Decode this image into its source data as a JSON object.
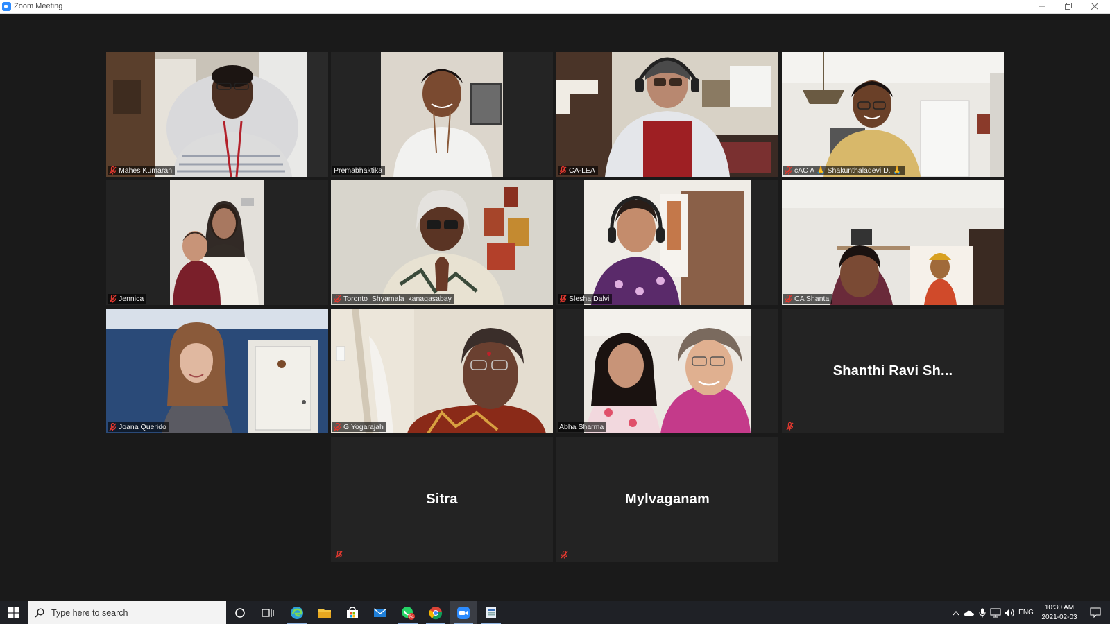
{
  "window": {
    "title": "Zoom Meeting"
  },
  "participants": [
    {
      "name": "Mahes Kumaran",
      "muted": true,
      "video": true
    },
    {
      "name": "Premabhaktika",
      "muted": false,
      "video": true,
      "active_speaker": true
    },
    {
      "name": "CA-LEA",
      "muted": true,
      "video": true
    },
    {
      "name": "cAC A 🙏 Shakunthaladevi D. 🙏",
      "muted": true,
      "video": true
    },
    {
      "name": "Jennica",
      "muted": true,
      "video": true
    },
    {
      "name": "Toronto  Shyamala  kanagasabay",
      "muted": true,
      "video": true
    },
    {
      "name": "Slesha Dalvi",
      "muted": true,
      "video": true
    },
    {
      "name": "CA Shanta",
      "muted": true,
      "video": true
    },
    {
      "name": "Joana Querido",
      "muted": true,
      "video": true
    },
    {
      "name": "G Yogarajah",
      "muted": true,
      "video": true
    },
    {
      "name": "Abha Sharma",
      "muted": false,
      "video": true
    },
    {
      "name": "Shanthi Ravi Sh...",
      "muted": true,
      "video": false
    },
    {
      "name": "Sitra",
      "muted": true,
      "video": false
    },
    {
      "name": "Mylvaganam",
      "muted": true,
      "video": false
    }
  ],
  "taskbar": {
    "search_placeholder": "Type here to search",
    "apps": [
      "cortana-icon",
      "task-view-icon",
      "edge-icon",
      "file-explorer-icon",
      "store-icon",
      "mail-icon",
      "whatsapp-icon",
      "chrome-icon",
      "zoom-icon",
      "app-icon"
    ],
    "whatsapp_badge": "24",
    "language": "ENG",
    "time": "10:30 AM",
    "date": "2021-02-03"
  },
  "colors": {
    "active_speaker_border": "#e6f07e",
    "muted_mic": "#e0382f",
    "tile_bg": "#232323"
  }
}
